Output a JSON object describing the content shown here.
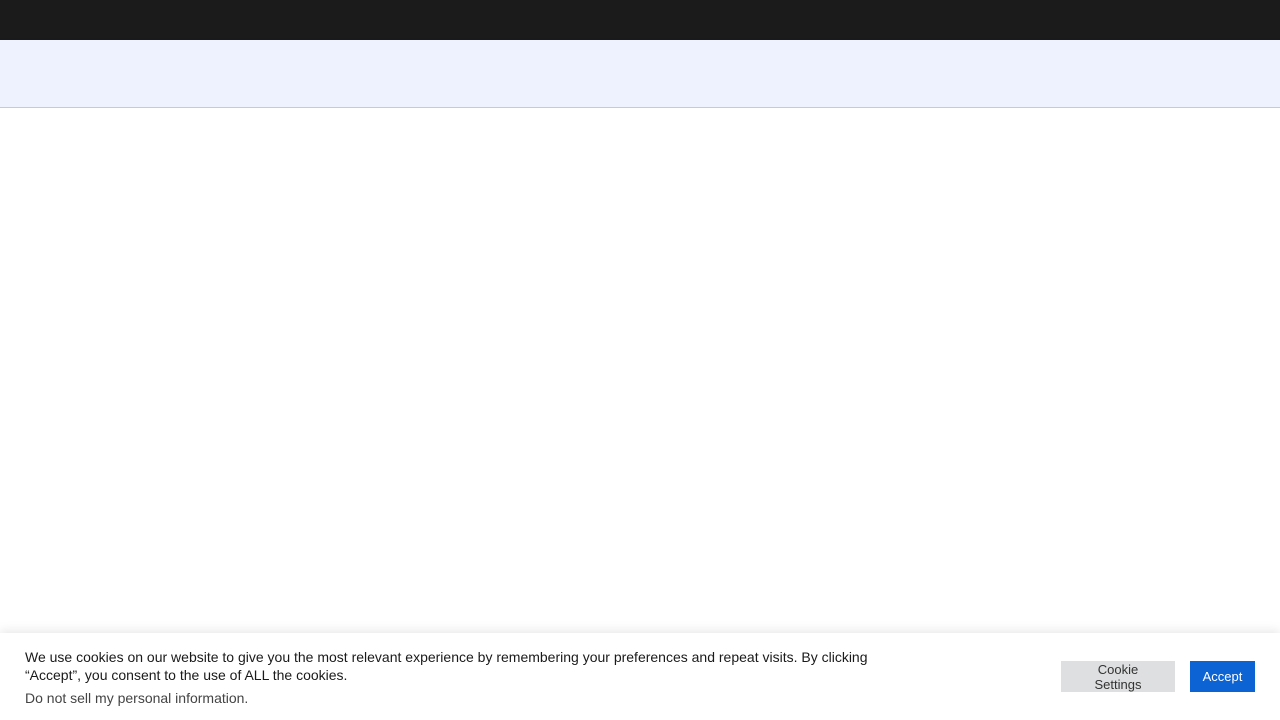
{
  "cookie_banner": {
    "message": "We use cookies on our website to give you the most relevant experience by remembering your preferences and repeat visits. By clicking “Accept”, you consent to the use of ALL the cookies.",
    "do_not_sell_link": "Do not sell my personal information.",
    "settings_button": "Cookie Settings",
    "accept_button": "Accept"
  },
  "colors": {
    "top_bar": "#1b1b1b",
    "header_band": "#edf2fe",
    "accept_button": "#0c63d4",
    "settings_button": "#dedfe0"
  }
}
